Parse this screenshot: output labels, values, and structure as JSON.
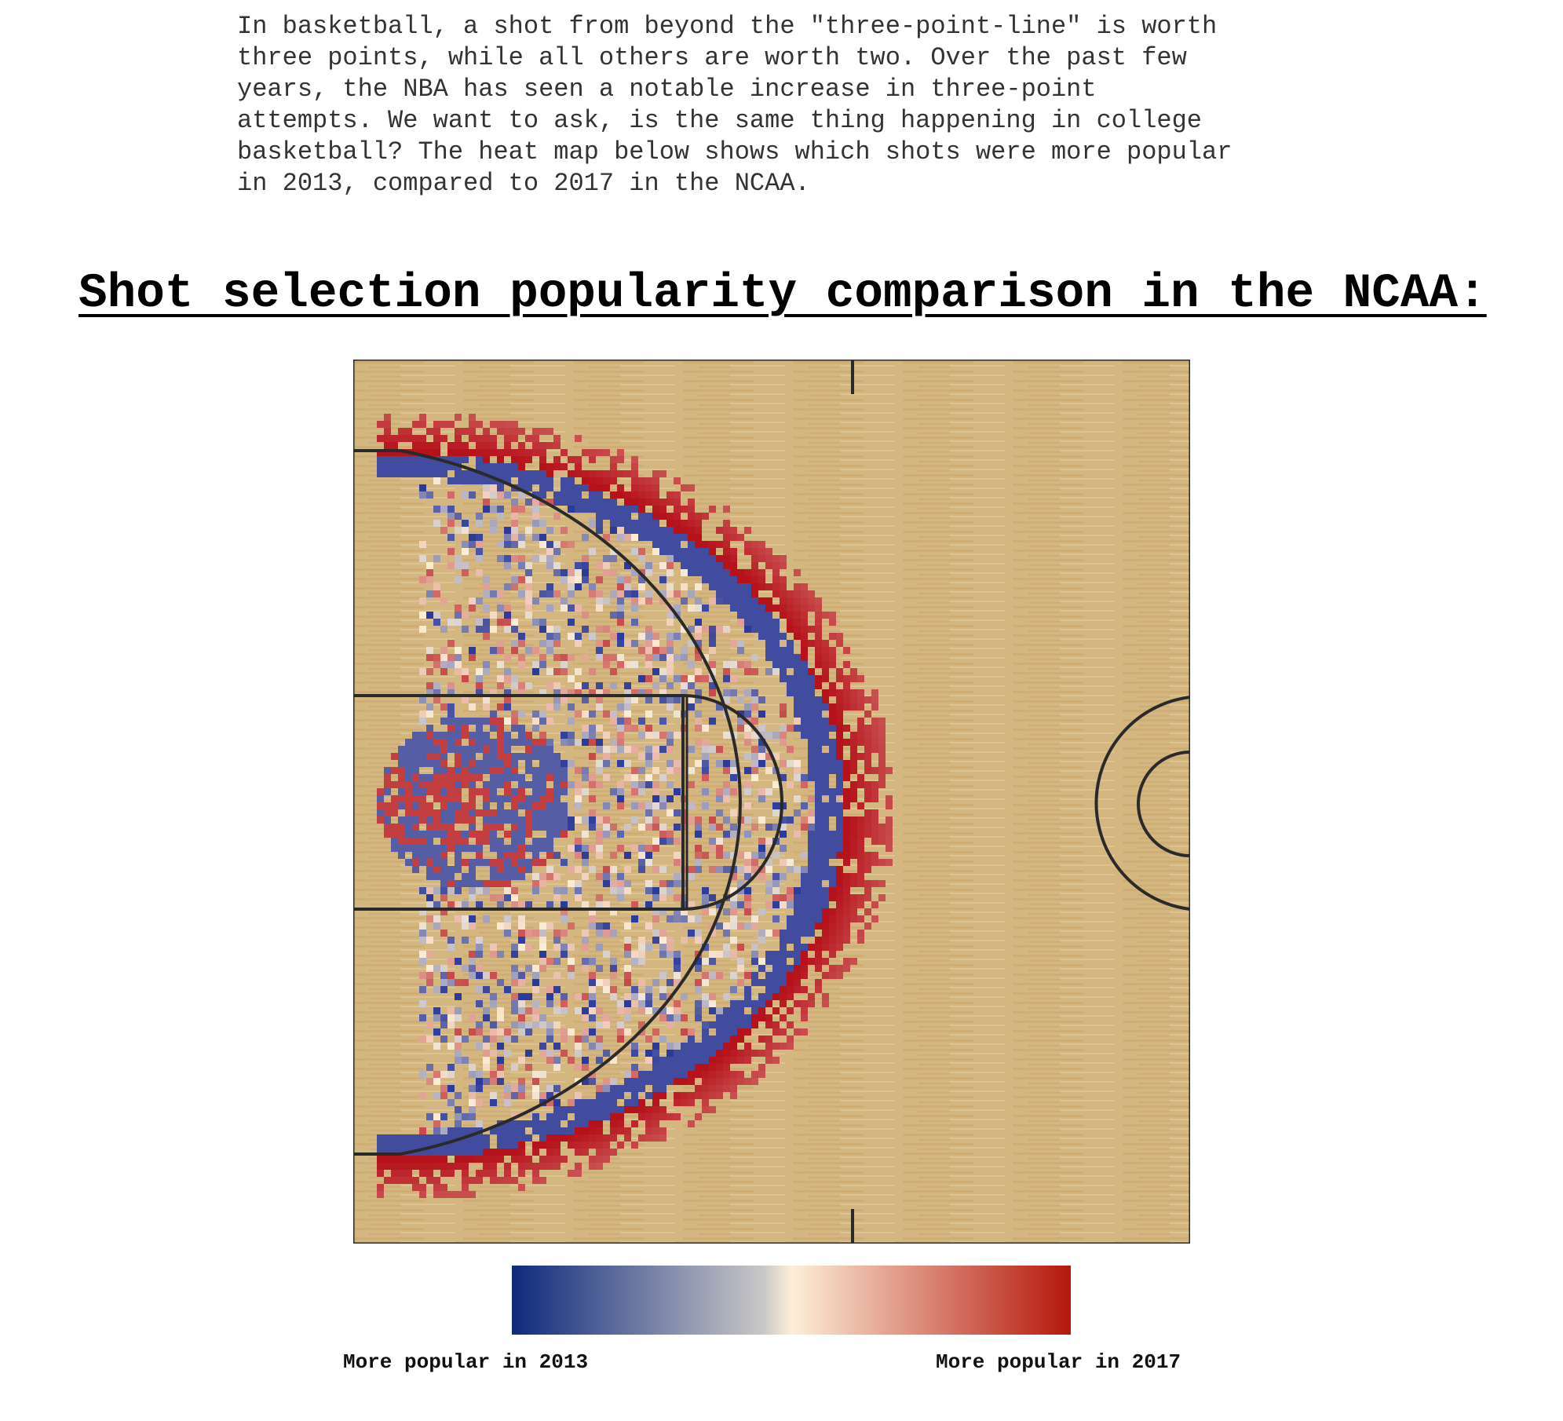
{
  "intro_text": "In basketball, a shot from beyond the \"three-point-line\" is worth\nthree points, while all others are worth two. Over the past few\nyears, the NBA has seen a notable increase in three-point\nattempts. We want to ask, is the same thing happening in college\nbasketball? The heat map below shows which shots were more popular\nin 2013, compared to 2017 in the NCAA.",
  "title": "Shot selection popularity comparison in the NCAA:",
  "colors": {
    "court_wood": "#d4b680",
    "court_line": "#2a2a2a",
    "more_2013": "#2c3a99",
    "neutral": "#fbeed6",
    "more_2017": "#b5121b"
  },
  "chart_data": {
    "type": "heatmap",
    "description_of_values": "diverging scale: negative = more popular in 2013, positive = more popular in 2017",
    "scale_range": [
      -1,
      1
    ],
    "zones": [
      {
        "zone": "three-point arc (just behind line)",
        "value": 0.9
      },
      {
        "zone": "three-point line / just inside",
        "value": -0.9
      },
      {
        "zone": "mid-range (inside arc)",
        "value": -0.15
      },
      {
        "zone": "restricted area (near basket)",
        "value": -0.8
      },
      {
        "zone": "at the rim (close)",
        "value": 0.8
      },
      {
        "zone": "backcourt",
        "value": 0.0
      }
    ],
    "colorbar": {
      "colors": [
        "#0f2a7d",
        "#c9c7c7",
        "#fdefd8",
        "#b5170c"
      ],
      "left_label": "More popular in 2013",
      "right_label": "More popular in 2017"
    }
  }
}
